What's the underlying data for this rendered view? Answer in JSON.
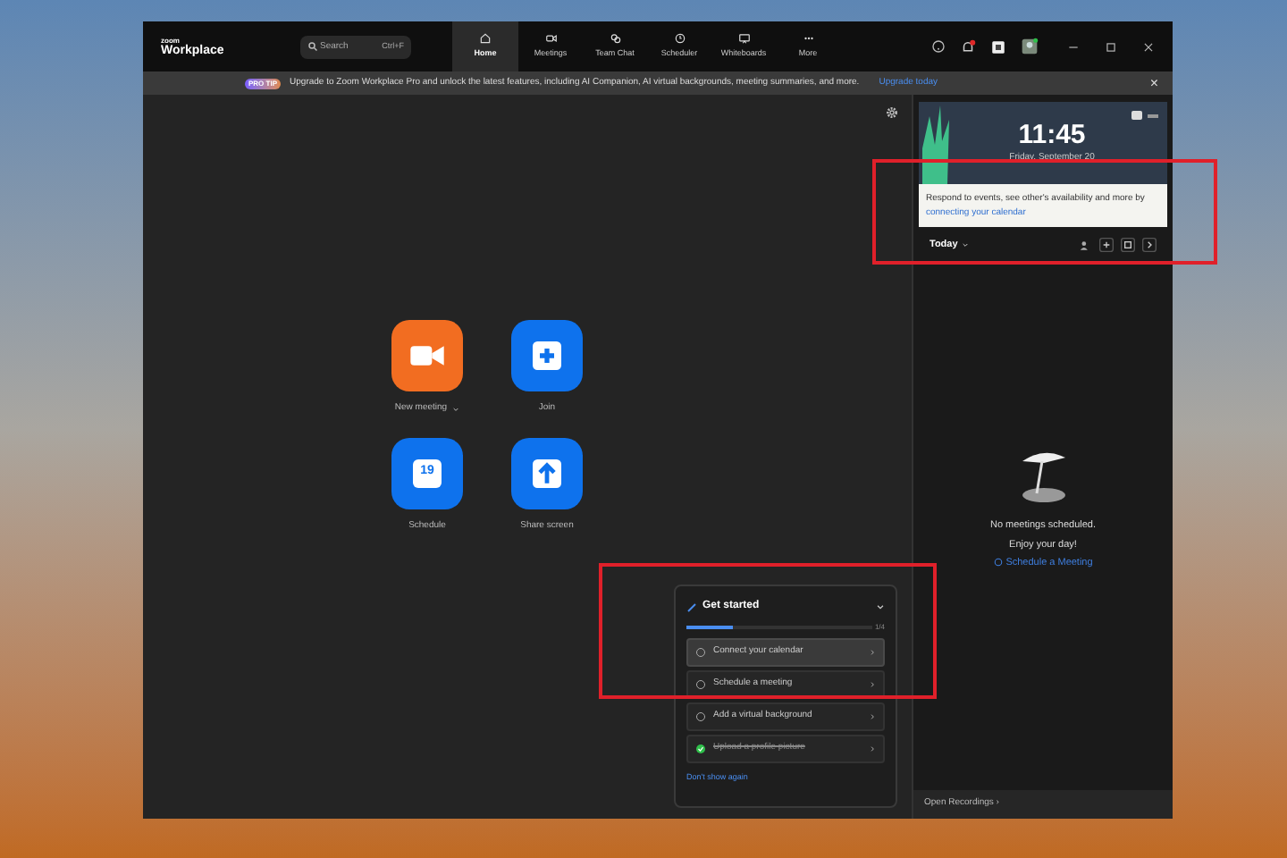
{
  "app": {
    "brand_small": "zoom",
    "brand": "Workplace"
  },
  "search": {
    "placeholder": "Search",
    "shortcut": "Ctrl+F"
  },
  "nav_tabs": [
    {
      "label": "Home",
      "selected": true
    },
    {
      "label": "Meetings",
      "selected": false
    },
    {
      "label": "Team Chat",
      "selected": false
    },
    {
      "label": "Scheduler",
      "selected": false
    },
    {
      "label": "Whiteboards",
      "selected": false
    },
    {
      "label": "More",
      "selected": false
    }
  ],
  "banner": {
    "badge": "PRO TIP",
    "text": "Upgrade to Zoom Workplace Pro and unlock the latest features, including AI Companion,  AI virtual backgrounds, meeting summaries, and more.",
    "link": "Upgrade today",
    "close": "×"
  },
  "actions": [
    {
      "label": "New meeting",
      "color": "#f26d21",
      "has_menu": true
    },
    {
      "label": "Join",
      "color": "#0e72ed",
      "has_menu": false
    },
    {
      "label": "Schedule",
      "color": "#0e72ed",
      "has_menu": false,
      "icon_text": "19"
    },
    {
      "label": "Share screen",
      "color": "#0e72ed",
      "has_menu": false
    }
  ],
  "get_started": {
    "title": "Get started",
    "progress": "1/4",
    "level": 0.25,
    "tasks": [
      {
        "label": "Connect your calendar",
        "done": false,
        "selected": true
      },
      {
        "label": "Schedule a meeting",
        "done": false,
        "selected": false
      },
      {
        "label": "Add a virtual background",
        "done": false,
        "selected": false
      },
      {
        "label": "Upload a profile picture",
        "done": true,
        "selected": false
      }
    ],
    "dismiss": "Don't show again"
  },
  "calendar": {
    "time": "11:45",
    "date": "Friday, September 20",
    "tip": "Respond to events, see other's availability and more by ",
    "tip_link": "connecting your calendar",
    "day": "Today",
    "empty_title": "No meetings scheduled.",
    "empty_subtitle": "Enjoy your day!",
    "schedule_link": "Schedule a Meeting",
    "recordings": "Open Recordings ›"
  },
  "annotations": [
    {
      "kind": "box"
    },
    {
      "kind": "box"
    }
  ]
}
